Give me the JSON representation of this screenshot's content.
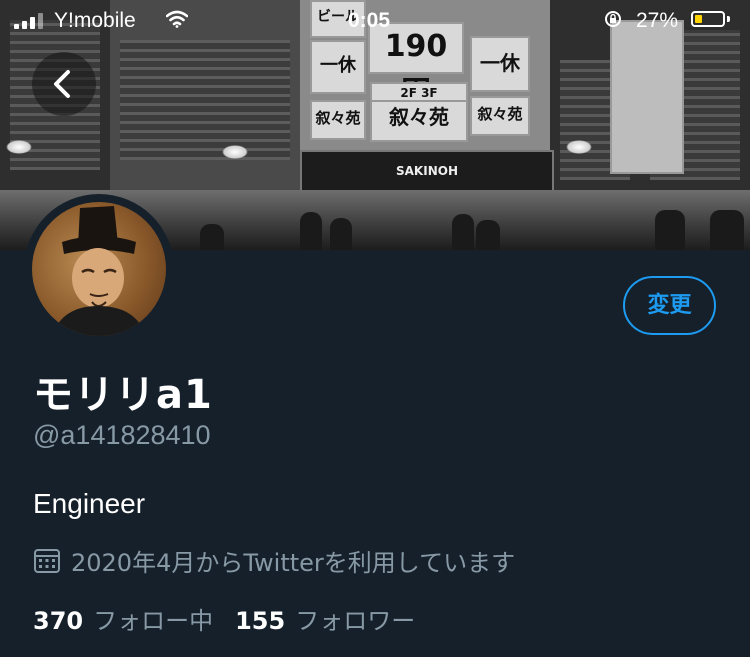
{
  "status_bar": {
    "carrier": "Y!mobile",
    "time": "0:05",
    "battery_percent": "27%",
    "battery_level": 0.27,
    "icons": [
      "signal-icon",
      "wifi-icon",
      "orientation-lock-icon",
      "battery-icon"
    ]
  },
  "header": {
    "back_icon": "chevron-left-icon",
    "banner_signs": {
      "price": "190円",
      "shop_top": "ビール",
      "shop_brand": "一休",
      "restaurant": "叙々苑",
      "restaurant_sub": "SAKINOH",
      "stairs": "2F 3F"
    }
  },
  "profile": {
    "display_name": "モリリa1",
    "handle": "@a141828410",
    "bio": "Engineer",
    "joined": "2020年4月からTwitterを利用しています",
    "edit_button": "変更",
    "following_count": "370",
    "following_label": "フォロー中",
    "followers_count": "155",
    "followers_label": "フォロワー"
  },
  "colors": {
    "background": "#15202b",
    "accent": "#1d9bf0",
    "secondary_text": "#8899a6",
    "battery": "#ffd400"
  }
}
